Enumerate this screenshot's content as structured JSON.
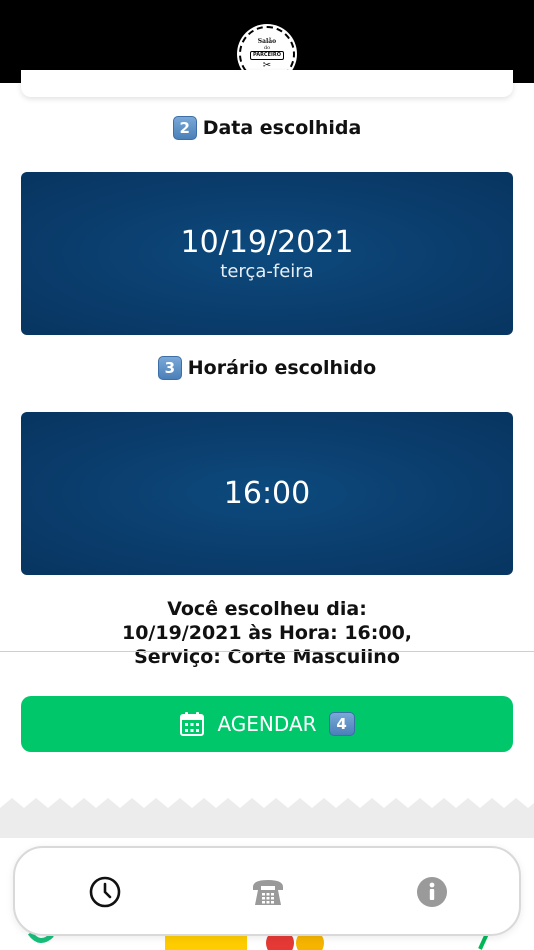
{
  "header": {
    "logo": {
      "line1": "Salão",
      "line2": "do",
      "line3": "PARCEIRO",
      "icon": "scissors-icon"
    }
  },
  "date_section": {
    "step": "2",
    "title": "Data escolhida",
    "date": "10/19/2021",
    "weekday": "terça-feira"
  },
  "time_section": {
    "step": "3",
    "title": "Horário escolhido",
    "time": "16:00"
  },
  "summary": {
    "line1": "Você escolheu dia:",
    "line2": "10/19/2021 às Hora: 16:00,",
    "line3": "Serviço: Corte Masculino"
  },
  "agendar_button": {
    "label": "AGENDAR",
    "step": "4",
    "icon": "calendar-icon"
  },
  "tabbar": {
    "items": [
      {
        "icon": "clock-icon",
        "active": true
      },
      {
        "icon": "phone-icon",
        "active": false
      },
      {
        "icon": "info-icon",
        "active": false
      }
    ]
  },
  "colors": {
    "card_blue": "#0a3c6b",
    "button_green": "#00c86a",
    "header_black": "#000000"
  }
}
